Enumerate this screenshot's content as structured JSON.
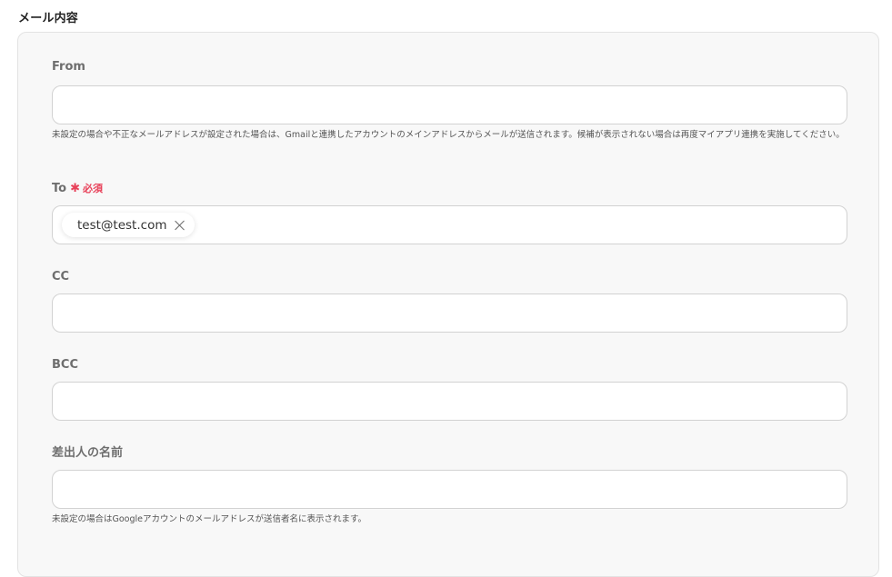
{
  "section": {
    "title": "メール内容"
  },
  "from": {
    "label": "From",
    "value": "",
    "help": "未設定の場合や不正なメールアドレスが設定された場合は、Gmailと連携したアカウントのメインアドレスからメールが送信されます。候補が表示されない場合は再度マイアプリ連携を実施してください。"
  },
  "to": {
    "label": "To",
    "required_mark": "✱",
    "required_text": "必須",
    "chips": [
      "test@test.com"
    ],
    "remove_icon": "close-icon"
  },
  "cc": {
    "label": "CC",
    "value": ""
  },
  "bcc": {
    "label": "BCC",
    "value": ""
  },
  "sender_name": {
    "label": "差出人の名前",
    "value": "",
    "help": "未設定の場合はGoogleアカウントのメールアドレスが送信者名に表示されます。"
  },
  "colors": {
    "required": "#e8425a",
    "card_bg": "#f8f8f8",
    "border": "#d2d2d2"
  }
}
